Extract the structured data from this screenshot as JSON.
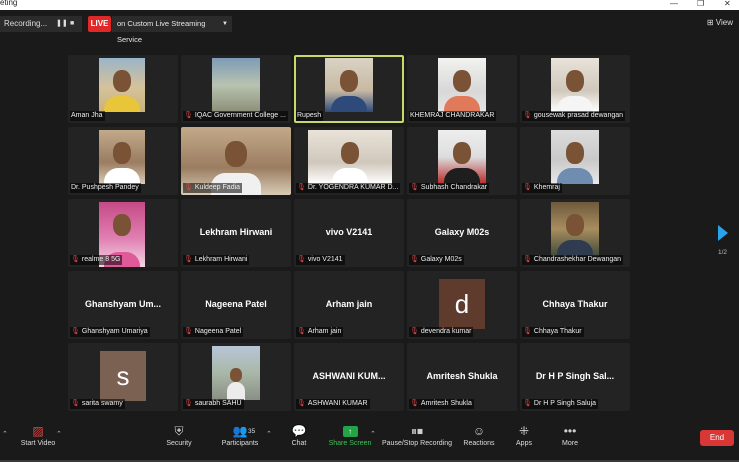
{
  "titlebar": {
    "title": "eting",
    "minimize": "—",
    "restore": "❐",
    "close": "✕"
  },
  "topbar": {
    "recording": "Recording...",
    "pause_icon": "pause-icon",
    "stop_icon": "stop-icon",
    "live_badge": "LIVE",
    "stream_service": "on Custom Live Streaming Service",
    "view_label": "View"
  },
  "tiles": [
    {
      "label": "Aman Jha",
      "muted": false,
      "type": "photo"
    },
    {
      "label": "IQAC Government College ...",
      "muted": true,
      "type": "photo"
    },
    {
      "label": "Rupesh",
      "muted": false,
      "type": "photo",
      "active": true
    },
    {
      "label": "KHEMRAJ CHANDRAKAR",
      "muted": false,
      "type": "photo"
    },
    {
      "label": "gousewak prasad dewangan",
      "muted": true,
      "type": "photo"
    },
    {
      "label": "Dr. Pushpesh  Pandey",
      "muted": false,
      "type": "photo"
    },
    {
      "label": "Kuldeep Fadia",
      "muted": true,
      "type": "photo"
    },
    {
      "label": "Dr. YOGENDRA KUMAR D...",
      "muted": true,
      "type": "photo"
    },
    {
      "label": "Subhash Chandrakar",
      "muted": true,
      "type": "photo"
    },
    {
      "label": "Khemraj",
      "muted": true,
      "type": "photo"
    },
    {
      "label": "realme 8 5G",
      "muted": true,
      "type": "photo"
    },
    {
      "label": "Lekhram Hirwani",
      "muted": true,
      "type": "name",
      "bigname": "Lekhram Hirwani"
    },
    {
      "label": "vivo V2141",
      "muted": true,
      "type": "name",
      "bigname": "vivo V2141"
    },
    {
      "label": "Galaxy M02s",
      "muted": true,
      "type": "name",
      "bigname": "Galaxy M02s"
    },
    {
      "label": "Chandrashekhar Dewangan",
      "muted": true,
      "type": "photo"
    },
    {
      "label": "Ghanshyam Umariya",
      "muted": true,
      "type": "name",
      "bigname": "Ghanshyam  Um..."
    },
    {
      "label": "Nageena Patel",
      "muted": true,
      "type": "name",
      "bigname": "Nageena Patel"
    },
    {
      "label": "Arham jain",
      "muted": true,
      "type": "name",
      "bigname": "Arham jain"
    },
    {
      "label": "devendra kumar",
      "muted": true,
      "type": "avatar",
      "initial": "d"
    },
    {
      "label": "Chhaya Thakur",
      "muted": true,
      "type": "name",
      "bigname": "Chhaya Thakur"
    },
    {
      "label": "sarita swamy",
      "muted": true,
      "type": "avatar",
      "initial": "s"
    },
    {
      "label": "saurabh SAHU",
      "muted": true,
      "type": "photo"
    },
    {
      "label": "ASHWANI KUMAR",
      "muted": true,
      "type": "name",
      "bigname": "ASHWANI  KUM..."
    },
    {
      "label": "Amritesh Shukla",
      "muted": true,
      "type": "name",
      "bigname": "Amritesh Shukla"
    },
    {
      "label": "Dr H P Singh Saluja",
      "muted": true,
      "type": "name",
      "bigname": "Dr H P Singh Sal..."
    }
  ],
  "pager": {
    "page": "1/2"
  },
  "toolbar": {
    "start_video": "Start Video",
    "security": "Security",
    "participants": "Participants",
    "participants_count": "35",
    "chat": "Chat",
    "share_screen": "Share Screen",
    "pause_stop_recording": "Pause/Stop Recording",
    "reactions": "Reactions",
    "apps": "Apps",
    "more": "More",
    "end": "End"
  },
  "colors": {
    "background": "#1a1a1a",
    "tile": "#232323",
    "live": "#e02828",
    "active_speaker": "#c8d86a",
    "share_green": "#22a447",
    "end_red": "#d93636",
    "pager_blue": "#2aa3ef"
  }
}
